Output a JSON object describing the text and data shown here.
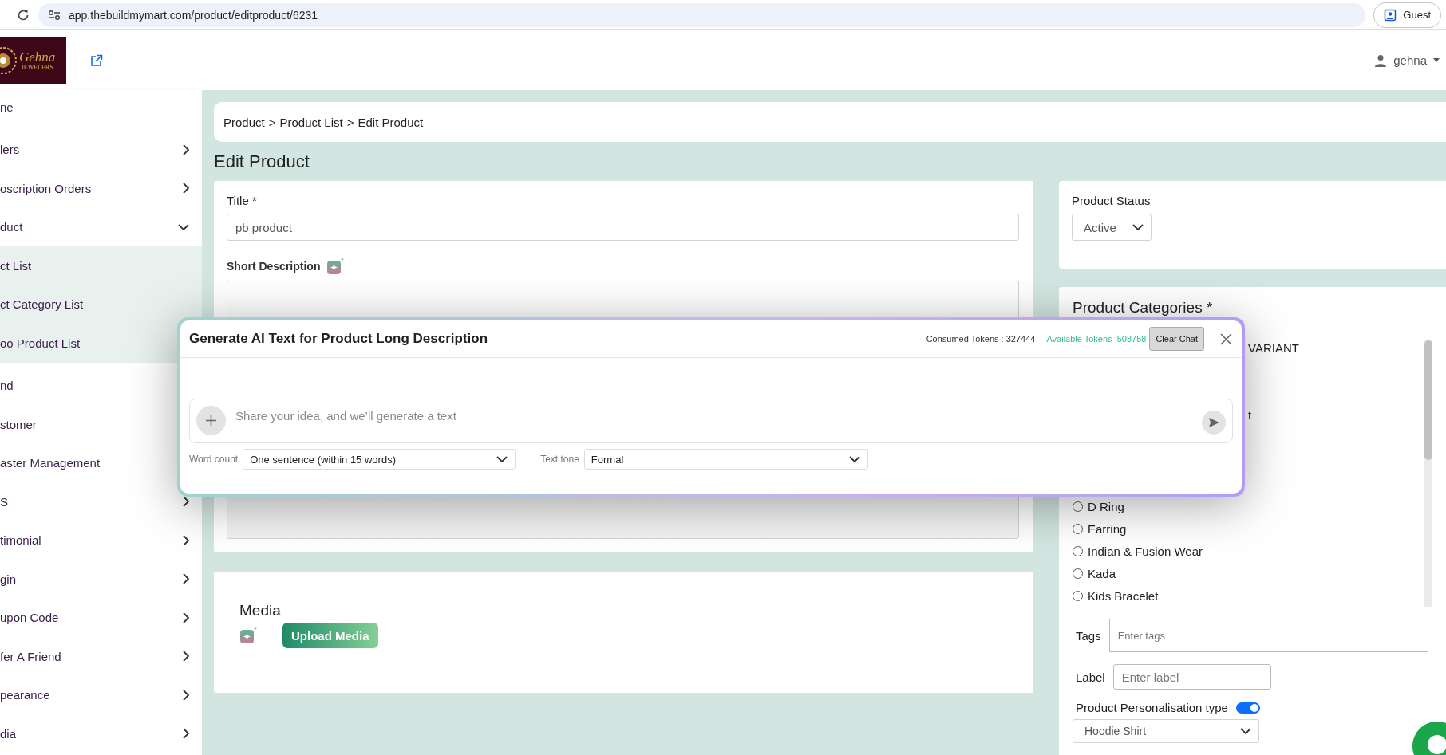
{
  "browser": {
    "url": "app.thebuildmymart.com/product/editproduct/6231",
    "profile_label": "Guest"
  },
  "header": {
    "logo": {
      "name": "Gehna",
      "tagline": "JEWELERS"
    },
    "user": "gehna"
  },
  "sidebar": {
    "items": [
      {
        "label": "ne",
        "kind": "link"
      },
      {
        "label": "lers",
        "kind": "group",
        "expanded": false
      },
      {
        "label": "oscription Orders",
        "kind": "group",
        "expanded": false
      },
      {
        "label": "duct",
        "kind": "group",
        "expanded": true,
        "children": [
          {
            "label": "ct List"
          },
          {
            "label": "ct Category List"
          },
          {
            "label": "oo Product List"
          }
        ]
      },
      {
        "label": "nd",
        "kind": "link"
      },
      {
        "label": "stomer",
        "kind": "link"
      },
      {
        "label": "aster Management",
        "kind": "link"
      },
      {
        "label": "S",
        "kind": "group",
        "expanded": false
      },
      {
        "label": "timonial",
        "kind": "group",
        "expanded": false
      },
      {
        "label": "gin",
        "kind": "group",
        "expanded": false
      },
      {
        "label": "upon Code",
        "kind": "group",
        "expanded": false
      },
      {
        "label": "fer A Friend",
        "kind": "group",
        "expanded": false
      },
      {
        "label": "pearance",
        "kind": "group",
        "expanded": false
      },
      {
        "label": "dia",
        "kind": "group",
        "expanded": false
      }
    ]
  },
  "breadcrumb": {
    "items": [
      "Product",
      "Product List",
      "Edit Product"
    ],
    "separator": ">"
  },
  "page_title": "Edit Product",
  "product_form": {
    "title_label": "Title *",
    "title_value": "pb product",
    "short_description_label": "Short Description"
  },
  "media": {
    "heading": "Media",
    "upload_button": "Upload Media"
  },
  "status": {
    "label": "Product Status",
    "value": "Active"
  },
  "categories": {
    "heading": "Product Categories *",
    "items": [
      {
        "kind": "fragment",
        "label": "VARIANT"
      },
      {
        "kind": "fragment",
        "label": "t"
      },
      {
        "kind": "radio",
        "label": "D Ring",
        "checked": false
      },
      {
        "kind": "radio",
        "label": "Earring",
        "checked": false
      },
      {
        "kind": "radio",
        "label": "Indian & Fusion Wear",
        "checked": false
      },
      {
        "kind": "radio",
        "label": "Kada",
        "checked": false
      },
      {
        "kind": "radio",
        "label": "Kids Bracelet",
        "checked": false
      }
    ]
  },
  "tags": {
    "label": "Tags",
    "placeholder": "Enter tags"
  },
  "label_field": {
    "label": "Label",
    "placeholder": "Enter label"
  },
  "personalisation": {
    "label": "Product Personalisation type",
    "on": true,
    "value": "Hoodie Shirt"
  },
  "ai_modal": {
    "title": "Generate AI Text for Product Long Description",
    "consumed_tokens": "Consumed Tokens : 327444",
    "available_tokens": "Available Tokens :508758",
    "clear_button": "Clear Chat",
    "prompt_placeholder": "Share your idea, and we’ll generate a text",
    "word_count": {
      "label": "Word count",
      "value": "One sentence (within 15 words)"
    },
    "text_tone": {
      "label": "Text tone",
      "value": "Formal"
    }
  }
}
